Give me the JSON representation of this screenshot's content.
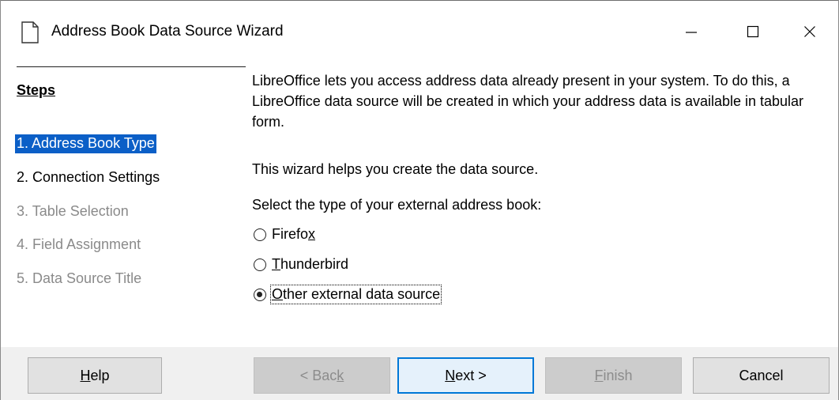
{
  "window": {
    "title": "Address Book Data Source Wizard",
    "minimize_label": "—",
    "maximize_label": "☐",
    "close_label": "✕"
  },
  "steps": {
    "heading": "Steps",
    "items": [
      {
        "label": "1. Address Book Type",
        "state": "active"
      },
      {
        "label": "2. Connection Settings",
        "state": "enabled"
      },
      {
        "label": "3. Table Selection",
        "state": "disabled"
      },
      {
        "label": "4. Field Assignment",
        "state": "disabled"
      },
      {
        "label": "5. Data Source Title",
        "state": "disabled"
      }
    ]
  },
  "content": {
    "intro": "LibreOffice lets you access address data already present in your system. To do this, a LibreOffice data source will be created in which your address data is available in tabular form.",
    "helper": "This wizard helps you create the data source.",
    "select_prompt": "Select the type of your external address book:",
    "options": [
      {
        "label_before": "Firefo",
        "mnemonic": "x",
        "label_after": "",
        "checked": false
      },
      {
        "label_before": "",
        "mnemonic": "T",
        "label_after": "hunderbird",
        "checked": false
      },
      {
        "label_before": "",
        "mnemonic": "O",
        "label_after": "ther external data source",
        "checked": true
      }
    ]
  },
  "buttons": {
    "help": {
      "before": "",
      "mnemonic": "H",
      "after": "elp"
    },
    "back": {
      "before": "< Bac",
      "mnemonic": "k",
      "after": ""
    },
    "next": {
      "before": "",
      "mnemonic": "N",
      "after": "ext >"
    },
    "finish": {
      "before": "",
      "mnemonic": "F",
      "after": "inish"
    },
    "cancel": {
      "text": "Cancel"
    }
  },
  "colors": {
    "selection": "#0b5fc7",
    "accent": "#0078d7",
    "disabled_text": "#8a8a8a"
  }
}
